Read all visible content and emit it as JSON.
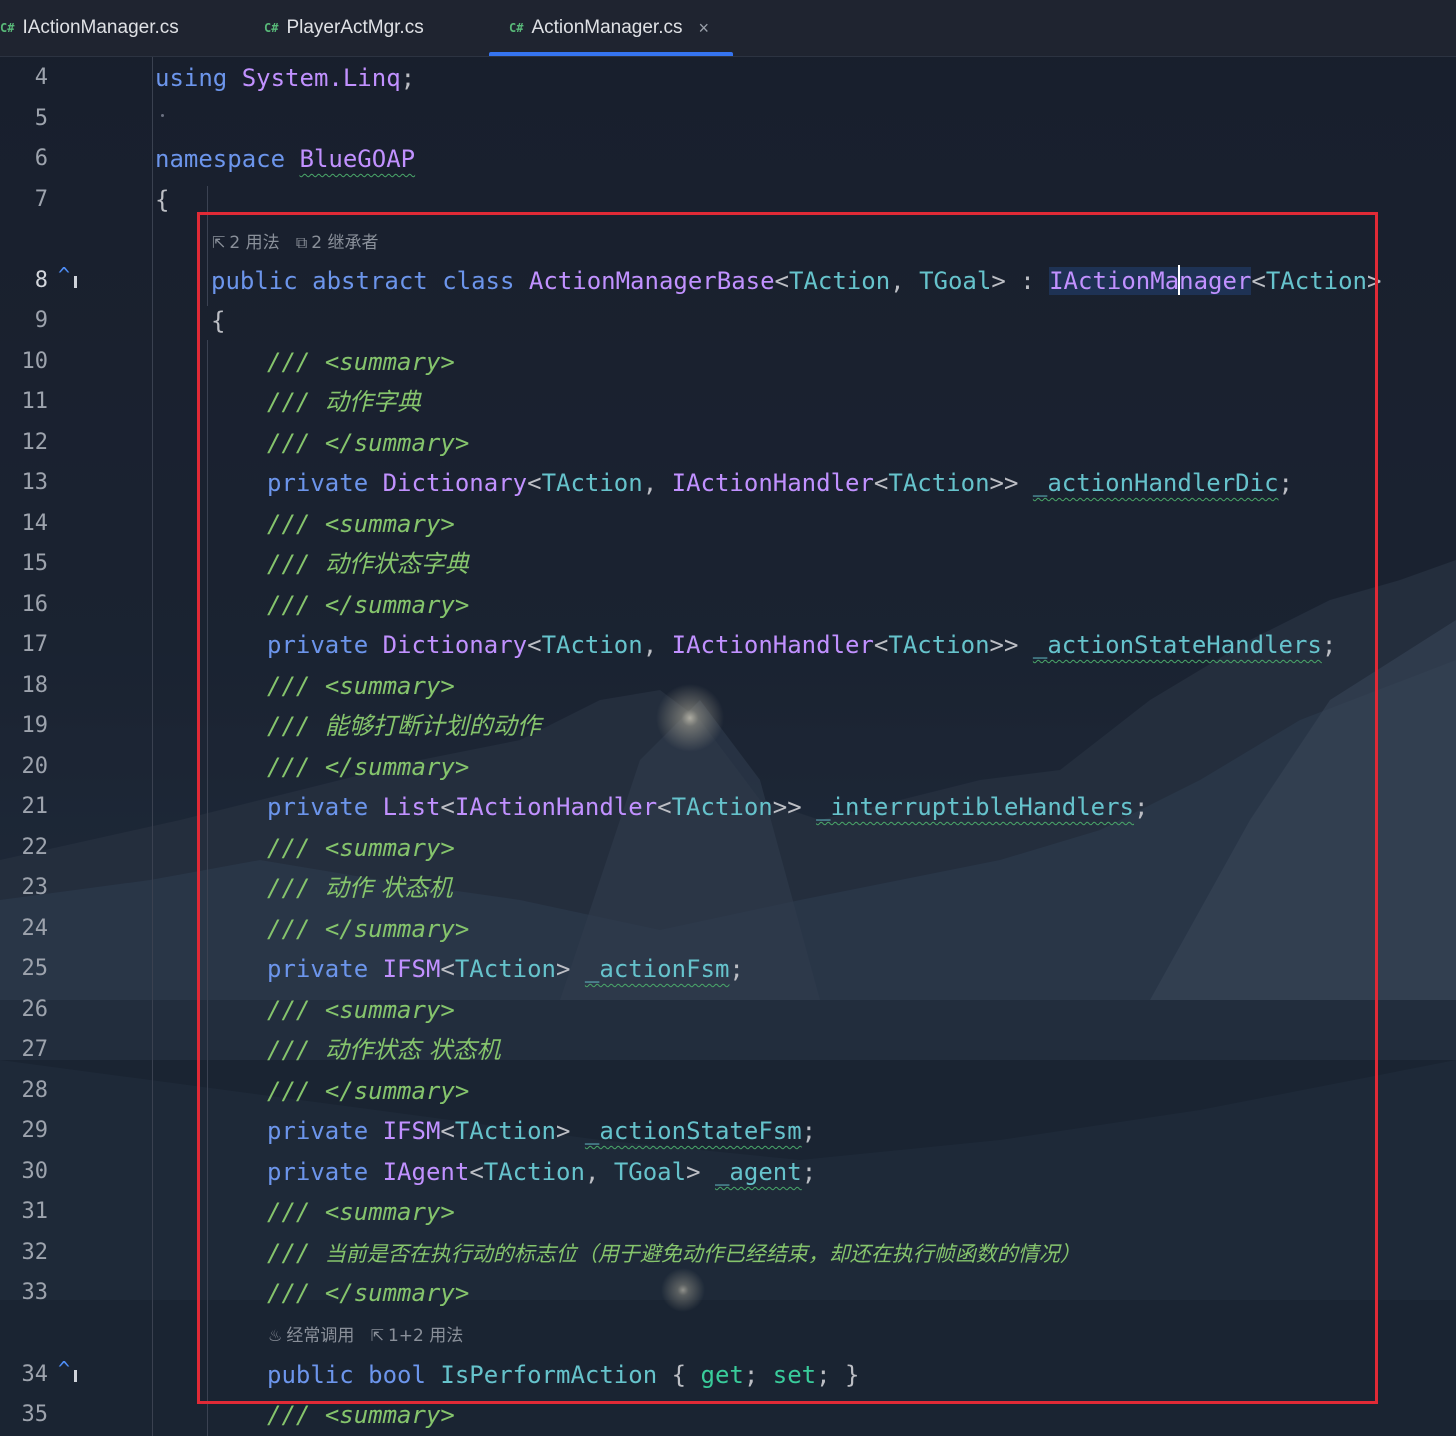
{
  "tabs": [
    {
      "lang": "C#",
      "label": "IActionManager.cs",
      "active": false
    },
    {
      "lang": "C#",
      "label": "PlayerActMgr.cs",
      "active": false
    },
    {
      "lang": "C#",
      "label": "ActionManager.cs",
      "active": true
    }
  ],
  "tab_close_glyph": "×",
  "gutter": {
    "line_numbers": [
      "4",
      "5",
      "6",
      "7",
      "8",
      "9",
      "10",
      "11",
      "12",
      "13",
      "14",
      "15",
      "16",
      "17",
      "18",
      "19",
      "20",
      "21",
      "22",
      "23",
      "24",
      "25",
      "26",
      "27",
      "28",
      "29",
      "30",
      "31",
      "32",
      "33",
      "34",
      "35"
    ],
    "current_line": "8",
    "inheritance_marker_lines": [
      "8",
      "34"
    ],
    "marker_glyph": "^"
  },
  "inlay_hints": {
    "class_hint": {
      "usages": "2 用法",
      "inheritors": "2 继承者"
    },
    "property_hint": {
      "frequent": "经常调用",
      "usages": "1+2 用法"
    }
  },
  "code": {
    "l4": {
      "kw": "using",
      "ns": "System.Linq",
      "punct": ";"
    },
    "l5": {
      "text": ""
    },
    "l6": {
      "kw": "namespace",
      "name": "BlueGOAP"
    },
    "l7": {
      "text": "{"
    },
    "l8": {
      "kw1": "public",
      "kw2": "abstract",
      "kw3": "class",
      "cls": "ActionManagerBase",
      "tp1": "TAction",
      "tp2": "TGoal",
      "base_a": "IActionMa",
      "base_b": "nager",
      "tp3": "TAction"
    },
    "l9": {
      "text": "{"
    },
    "l10": {
      "slashes": "///",
      "tag": "<summary>"
    },
    "l11": {
      "slashes": "///",
      "text": "动作字典"
    },
    "l12": {
      "slashes": "///",
      "tag": "</summary>"
    },
    "l13": {
      "kw": "private",
      "t1": "Dictionary",
      "tp1": "TAction",
      "t2": "IActionHandler",
      "tp2": "TAction",
      "field": "_actionHandlerDic"
    },
    "l14": {
      "slashes": "///",
      "tag": "<summary>"
    },
    "l15": {
      "slashes": "///",
      "text": "动作状态字典"
    },
    "l16": {
      "slashes": "///",
      "tag": "</summary>"
    },
    "l17": {
      "kw": "private",
      "t1": "Dictionary",
      "tp1": "TAction",
      "t2": "IActionHandler",
      "tp2": "TAction",
      "field": "_actionStateHandlers"
    },
    "l18": {
      "slashes": "///",
      "tag": "<summary>"
    },
    "l19": {
      "slashes": "///",
      "text": "能够打断计划的动作"
    },
    "l20": {
      "slashes": "///",
      "tag": "</summary>"
    },
    "l21": {
      "kw": "private",
      "t1": "List",
      "t2": "IActionHandler",
      "tp1": "TAction",
      "field": "_interruptibleHandlers"
    },
    "l22": {
      "slashes": "///",
      "tag": "<summary>"
    },
    "l23": {
      "slashes": "///",
      "text": "动作 状态机"
    },
    "l24": {
      "slashes": "///",
      "tag": "</summary>"
    },
    "l25": {
      "kw": "private",
      "t1": "IFSM",
      "tp1": "TAction",
      "field": "_actionFsm"
    },
    "l26": {
      "slashes": "///",
      "tag": "<summary>"
    },
    "l27": {
      "slashes": "///",
      "text": "动作状态 状态机"
    },
    "l28": {
      "slashes": "///",
      "tag": "</summary>"
    },
    "l29": {
      "kw": "private",
      "t1": "IFSM",
      "tp1": "TAction",
      "field": "_actionStateFsm"
    },
    "l30": {
      "kw": "private",
      "t1": "IAgent",
      "tp1": "TAction",
      "tp2": "TGoal",
      "field": "_agent"
    },
    "l31": {
      "slashes": "///",
      "tag": "<summary>"
    },
    "l32": {
      "slashes": "///",
      "text": "当前是否在执行动的标志位（用于避免动作已经结束，却还在执行帧函数的情况）"
    },
    "l33": {
      "slashes": "///",
      "tag": "</summary>"
    },
    "l34": {
      "kw1": "public",
      "kw2": "bool",
      "prop": "IsPerformAction",
      "get": "get",
      "set": "set"
    },
    "l35": {
      "slashes": "///",
      "tag": "<summary>"
    }
  },
  "colors": {
    "keyword": "#6c95eb",
    "type": "#c191ff",
    "type_param": "#66c3cc",
    "comment": "#85c46c",
    "annotation_box": "#e02a36",
    "active_tab_underline": "#3574f0"
  }
}
